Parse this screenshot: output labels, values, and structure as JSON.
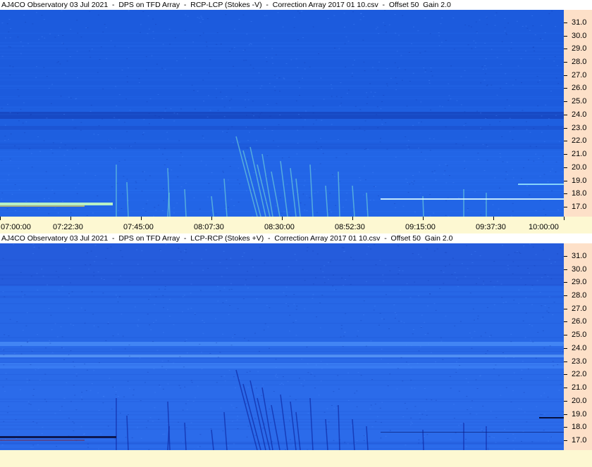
{
  "panels": [
    {
      "title": "AJ4CO Observatory 03 Jul 2021  -  DPS on TFD Array  -  RCP-LCP (Stokes -V)  -  Correction Array 2017 01 10.csv  -  Offset 50  Gain 2.0",
      "polarity": "positive",
      "base_color": "#1e5fe0",
      "burst_color": "#7fe6d6"
    },
    {
      "title": "AJ4CO Observatory 03 Jul 2021  -  DPS on TFD Array  -  LCP-RCP (Stokes +V)  -  Correction Array 2017 01 10.csv  -  Offset 50  Gain 2.0",
      "polarity": "negative",
      "base_color": "#2a6ae8",
      "burst_color": "#0a1f9a"
    }
  ],
  "freq_axis": {
    "unit_range": [
      16.25,
      31.95
    ],
    "ticks": [
      "31.0",
      "30.0",
      "29.0",
      "28.0",
      "27.0",
      "26.0",
      "25.0",
      "24.0",
      "23.0",
      "22.0",
      "21.0",
      "20.0",
      "19.0",
      "18.0",
      "17.0"
    ]
  },
  "time_axis": {
    "labels": [
      "07:00:00",
      "07:22:30",
      "07:45:00",
      "08:07:30",
      "08:30:00",
      "08:52:30",
      "09:15:00",
      "09:37:30",
      "10:00:00"
    ]
  },
  "colors": {
    "background": "#fdf8d2",
    "axis_bg": "#fde0c8",
    "title_bg": "#ffffff"
  }
}
